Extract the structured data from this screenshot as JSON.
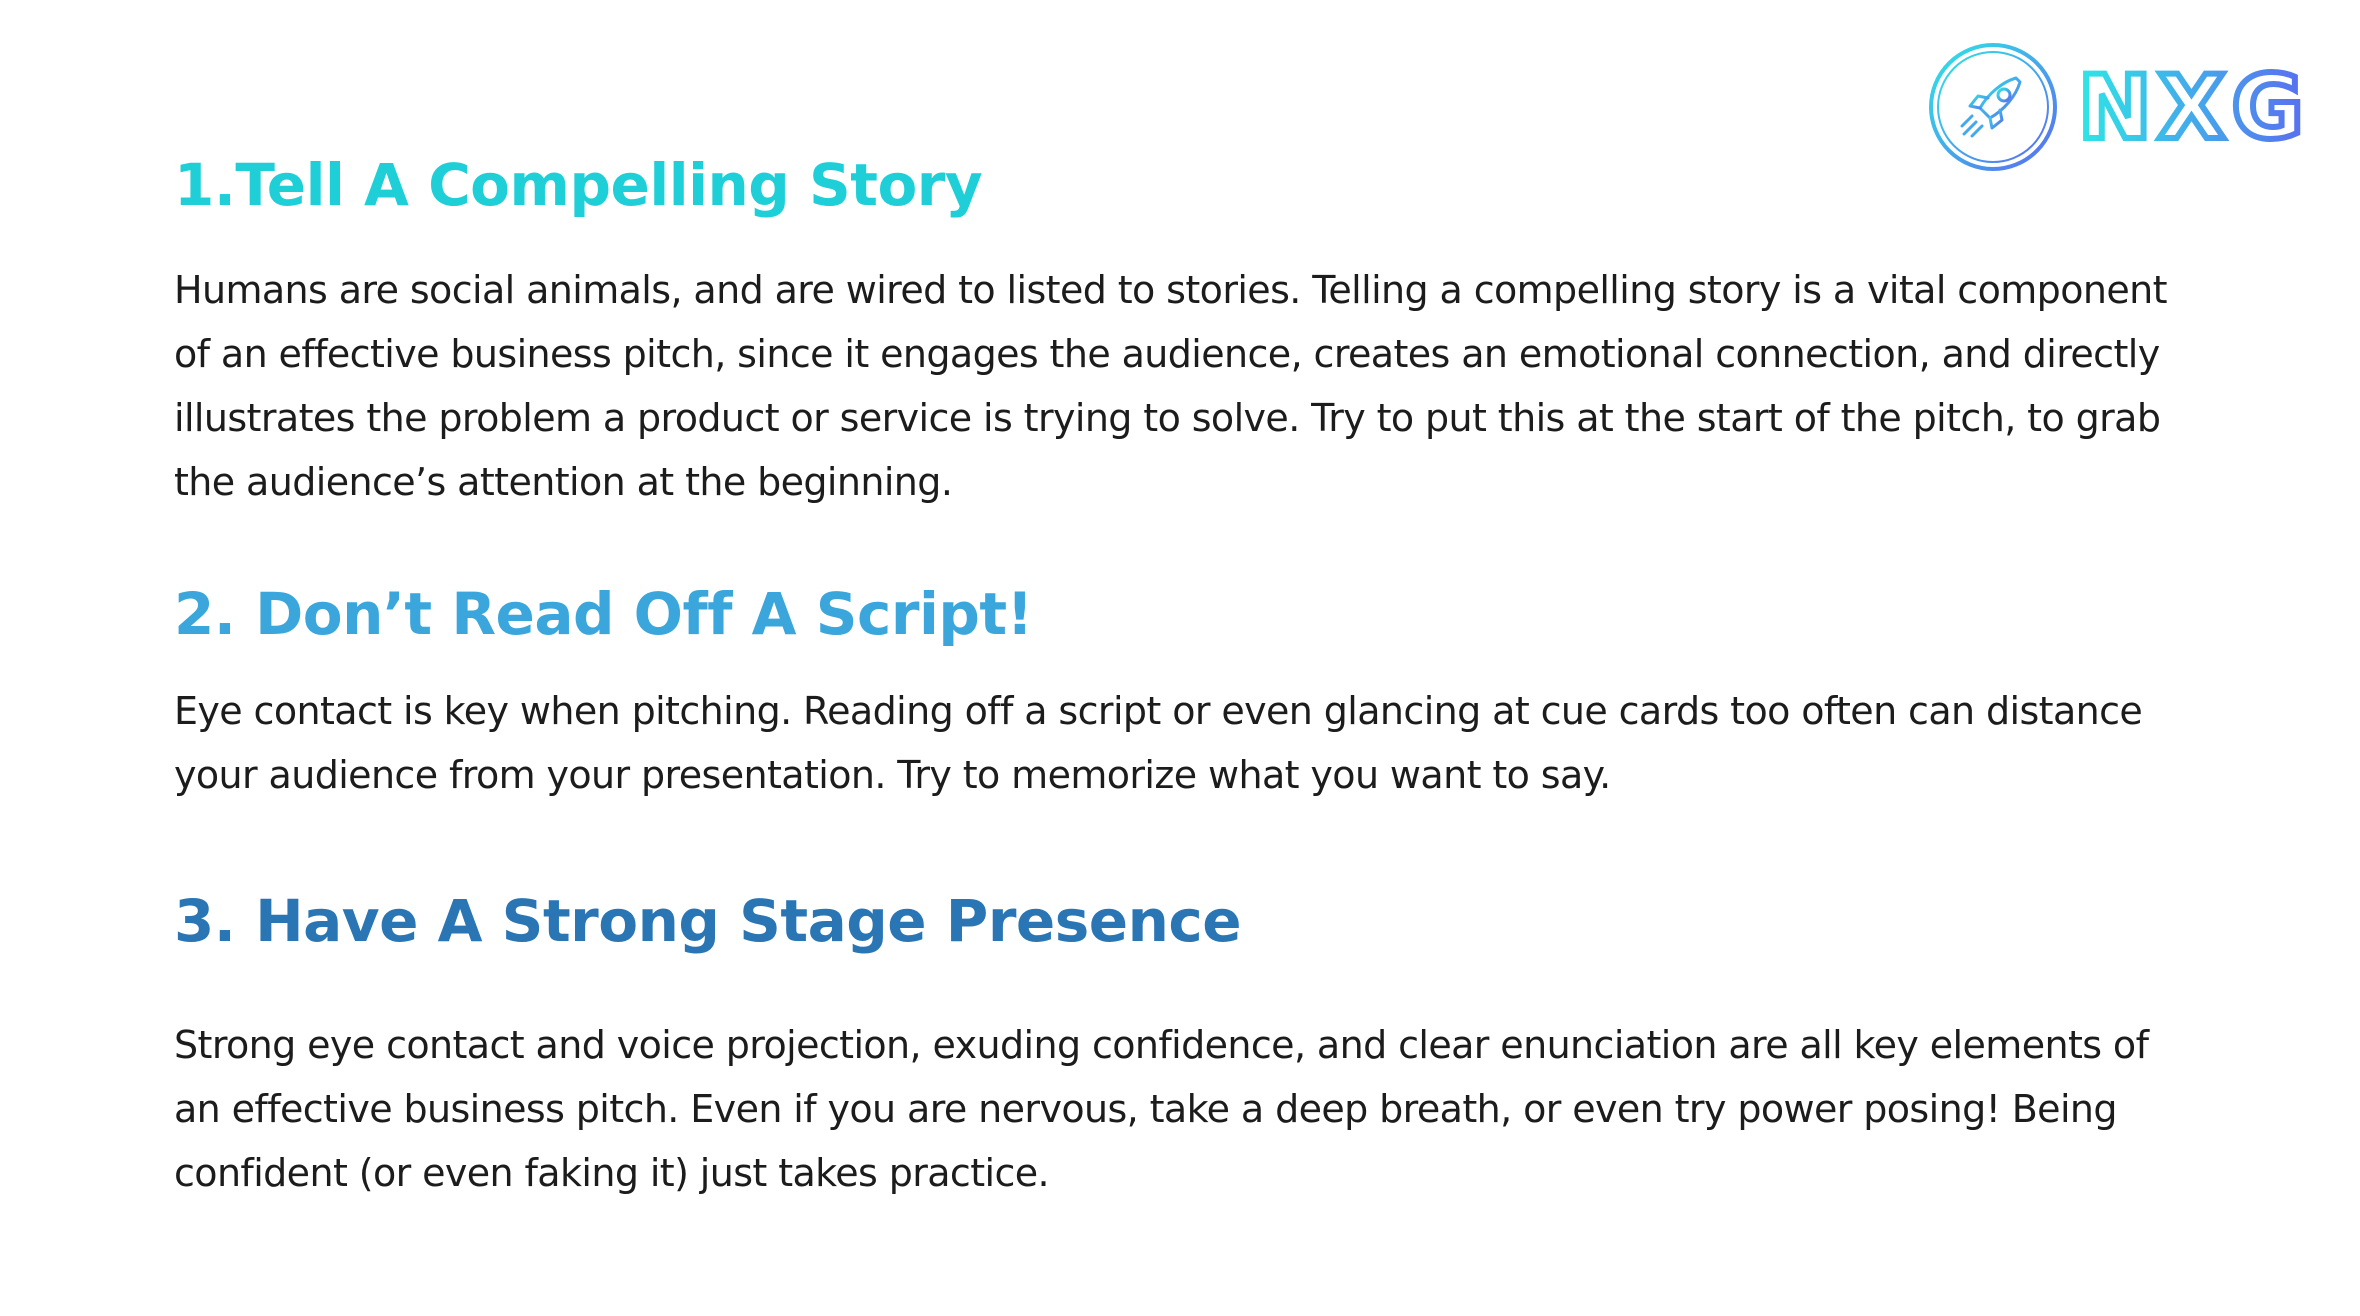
{
  "brand": {
    "name": "NXG",
    "icon": "rocket-icon",
    "colors": {
      "start": "#2ee6e6",
      "end": "#5a6cf0"
    }
  },
  "sections": [
    {
      "heading": "1.Tell A Compelling Story",
      "body": "Humans are social animals, and are wired to listed to stories. Telling a compelling story is a vital component of an effective business pitch, since it engages the audience, creates an emotional connection, and directly illustrates the problem a product or service is trying to solve. Try to put this at the start of the pitch, to grab the audience’s attention at the beginning.",
      "color": "#1ecfd8"
    },
    {
      "heading": "2. Don’t Read Off A Script!",
      "body": "Eye contact is key when pitching. Reading off a script or even glancing at cue cards too often can distance your audience from your presentation. Try to memorize what you want to say.",
      "color": "#3aa6dc"
    },
    {
      "heading": "3. Have A Strong Stage Presence",
      "body": "Strong eye contact and voice projection, exuding confidence, and clear enunciation are all key elements of an effective business pitch. Even if you are nervous, take a deep breath, or even try power posing! Being confident (or even faking it) just takes practice.",
      "color": "#2a75b4"
    }
  ]
}
